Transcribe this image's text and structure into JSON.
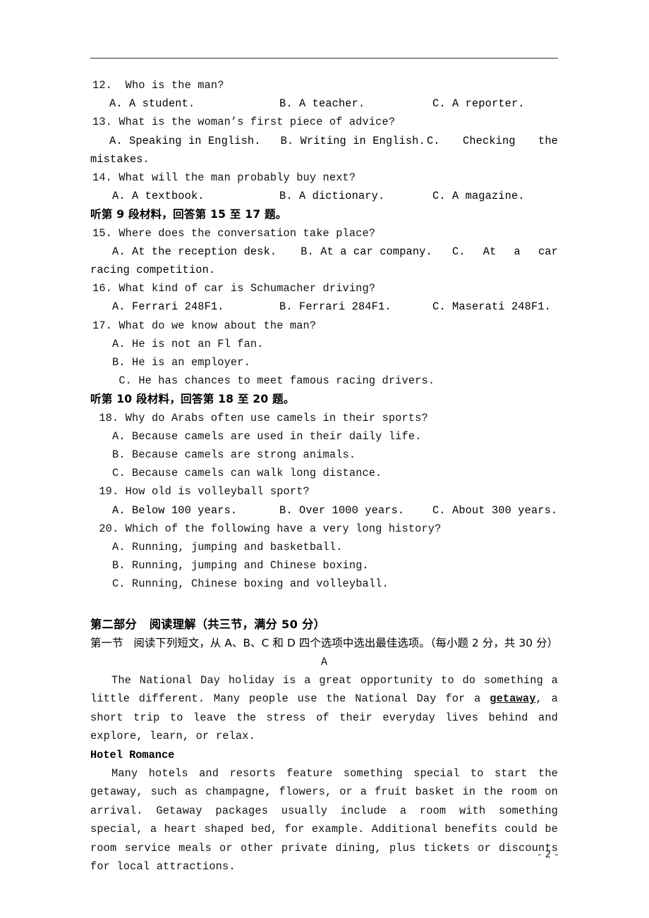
{
  "page": {
    "number_label": "- 2 -",
    "has_header_rule": true
  },
  "listening": {
    "questions": [
      {
        "id": "q12",
        "number": "12.",
        "stem": "12.  Who is the man?",
        "options_inline": {
          "a": "A. A student.",
          "b": "B. A teacher.",
          "c": "C. A reporter."
        }
      },
      {
        "id": "q13",
        "number": "13.",
        "stem": "13. What is the woman’s first piece of advice?",
        "options_justified": {
          "a": "A. Speaking in English.",
          "b": "B. Writing in English.",
          "c_label": "C.",
          "c_word1": "Checking",
          "c_word2": "the",
          "continuation": "mistakes."
        }
      },
      {
        "id": "q14",
        "number": "14.",
        "stem": "14. What will the man probably buy next?",
        "options_inline": {
          "a": "A. A textbook.",
          "b": "B. A dictionary.",
          "c": "C. A magazine."
        }
      }
    ],
    "heading_9": "听第 9 段材料，回答第 15 至 17 题。",
    "questions_9": [
      {
        "id": "q15",
        "number": "15.",
        "stem": "15. Where does the conversation take place?",
        "options_justified": {
          "a": "A. At the reception desk.",
          "b": "B. At a car company.",
          "c_label": "C.",
          "c_word1": "At",
          "c_word2": "a",
          "c_word3": "car",
          "continuation": "racing competition."
        }
      },
      {
        "id": "q16",
        "number": "16.",
        "stem": "16. What kind of car is Schumacher driving?",
        "options_inline": {
          "a": "A. Ferrari 248F1.",
          "b": "B. Ferrari 284F1.",
          "c": "C. Maserati 248F1."
        }
      },
      {
        "id": "q17",
        "number": "17.",
        "stem": "17. What do we know about the man?",
        "options_stacked": [
          "A. He is not an Fl fan.",
          "B. He is an employer.",
          " C. He has chances to meet famous racing drivers."
        ]
      }
    ],
    "heading_10": "听第 10 段材料，回答第 18 至 20 题。",
    "questions_10": [
      {
        "id": "q18",
        "number": "18.",
        "stem": " 18. Why do Arabs often use camels in their sports?",
        "options_stacked": [
          "A. Because camels are used in their daily life.",
          "B. Because camels are strong animals.",
          "C. Because camels can walk long distance."
        ]
      },
      {
        "id": "q19",
        "number": "19.",
        "stem": " 19. How old is volleyball sport?",
        "options_inline": {
          "a": "A. Below 100 years.",
          "b": "B. Over 1000 years.",
          "c": "C. About 300 years."
        }
      },
      {
        "id": "q20",
        "number": "20.",
        "stem": " 20. Which of the following have a very long history?",
        "options_stacked": [
          "A. Running, jumping and basketball.",
          "B. Running, jumping and Chinese boxing.",
          "C. Running, Chinese boxing and volleyball."
        ]
      }
    ]
  },
  "reading": {
    "part_heading": "第二部分   阅读理解（共三节，满分 50 分）",
    "section_heading": "第一节   阅读下列短文，从 A、B、C 和 D 四个选项中选出最佳选项。（每小题 2 分，共 30 分）",
    "passage_label": "A",
    "passage_intro_pre": "The National Day holiday is a great opportunity to do something a little different. Many people use the National Day for a ",
    "passage_intro_bold": "getaway",
    "passage_intro_post": ", a short trip to leave the stress of their everyday lives behind and explore, learn, or relax.",
    "subhead_hotel": "Hotel Romance",
    "passage_hotel": "Many hotels and resorts feature something special to start the getaway, such as champagne, flowers, or a fruit basket in the room on arrival. Getaway packages usually include a room with something special, a heart shaped bed, for example. Additional benefits could be room service meals or other private dining, plus tickets or discounts for local attractions."
  }
}
